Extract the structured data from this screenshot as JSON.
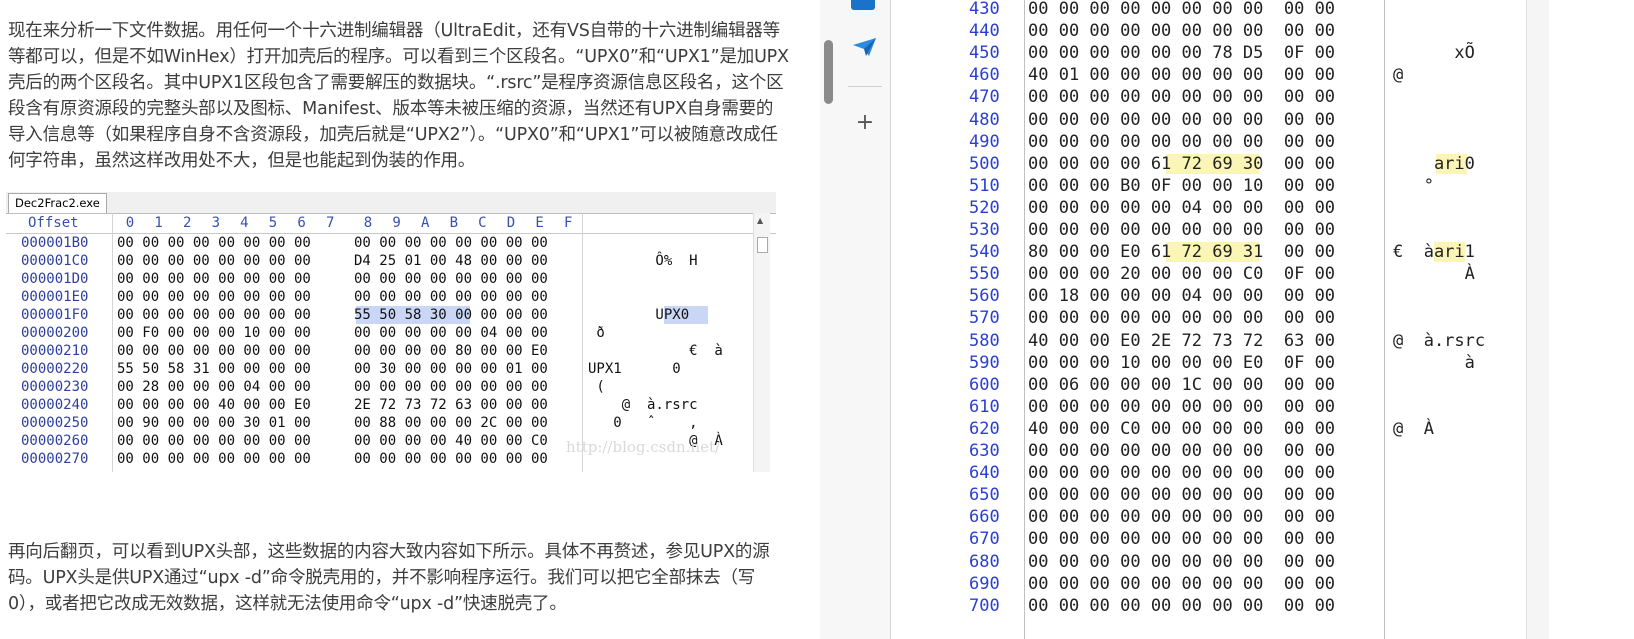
{
  "article": {
    "para1": [
      "现在来分析一下文件数据。用任何一个十六进制编辑器（UltraEdit，还有VS自带的十六进制编辑器等",
      "等都可以，但是不如WinHex）打开加壳后的程序。可以看到三个区段名。“UPX0”和“UPX1”是加UPX",
      "壳后的两个区段名。其中UPX1区段包含了需要解压的数据块。“.rsrc”是程序资源信息区段名，这个区",
      "段含有原资源段的完整头部以及图标、Manifest、版本等未被压缩的资源，当然还有UPX自身需要的",
      "导入信息等（如果程序自身不含资源段，加壳后就是“UPX2”）。“UPX0”和“UPX1”可以被随意改成任",
      "何字符串，虽然这样改用处不大，但是也能起到伪装的作用。"
    ],
    "para2": [
      "再向后翻页，可以看到UPX头部，这些数据的内容大致内容如下所示。具体不再赘述，参见UPX的源",
      "码。UPX头是供UPX通过“upx -d”命令脱壳用的，并不影响程序运行。我们可以把它全部抹去（写",
      "0），或者把它改成无效数据，这样就无法使用命令“upx -d”快速脱壳了。"
    ]
  },
  "winhex": {
    "tab": "Dec2Frac2.exe",
    "offset_label": "Offset",
    "columns": [
      "0",
      "1",
      "2",
      "3",
      "4",
      "5",
      "6",
      "7",
      "8",
      "9",
      "A",
      "B",
      "C",
      "D",
      "E",
      "F"
    ],
    "watermark": "http://blog.csdn.net/",
    "rows": [
      {
        "off": "000001B0",
        "h1": "00 00 00 00 00 00 00 00",
        "h2": "00 00 00 00 00 00 00 00",
        "asc": ""
      },
      {
        "off": "000001C0",
        "h1": "00 00 00 00 00 00 00 00",
        "h2": "D4 25 01 00 48 00 00 00",
        "asc": "        Ô%  H"
      },
      {
        "off": "000001D0",
        "h1": "00 00 00 00 00 00 00 00",
        "h2": "00 00 00 00 00 00 00 00",
        "asc": ""
      },
      {
        "off": "000001E0",
        "h1": "00 00 00 00 00 00 00 00",
        "h2": "00 00 00 00 00 00 00 00",
        "asc": ""
      },
      {
        "off": "000001F0",
        "h1": "00 00 00 00 00 00 00 00",
        "h2": "55 50 58 30 00 00 00 00",
        "asc": "        UPX0"
      },
      {
        "off": "00000200",
        "h1": "00 F0 00 00 00 10 00 00",
        "h2": "00 00 00 00 00 04 00 00",
        "asc": " ð"
      },
      {
        "off": "00000210",
        "h1": "00 00 00 00 00 00 00 00",
        "h2": "00 00 00 00 80 00 00 E0",
        "asc": "            €  à"
      },
      {
        "off": "00000220",
        "h1": "55 50 58 31 00 00 00 00",
        "h2": "00 30 00 00 00 00 01 00",
        "asc": "UPX1      0"
      },
      {
        "off": "00000230",
        "h1": "00 28 00 00 00 04 00 00",
        "h2": "00 00 00 00 00 00 00 00",
        "asc": " ("
      },
      {
        "off": "00000240",
        "h1": "00 00 00 00 40 00 00 E0",
        "h2": "2E 72 73 72 63 00 00 00",
        "asc": "    @  à.rsrc"
      },
      {
        "off": "00000250",
        "h1": "00 90 00 00 00 30 01 00",
        "h2": "00 88 00 00 00 2C 00 00",
        "asc": "   0   ˆ    ,"
      },
      {
        "off": "00000260",
        "h1": "00 00 00 00 00 00 00 00",
        "h2": "00 00 00 00 40 00 00 C0",
        "asc": "            @  À"
      },
      {
        "off": "00000270",
        "h1": "00 00 00 00 00 00 00 00",
        "h2": "00 00 00 00 00 00 00 00",
        "asc": ""
      }
    ]
  },
  "hexview": {
    "rows": [
      {
        "a": "430",
        "b": "00 00 00 00 00 00 00 00  00 00",
        "c": ""
      },
      {
        "a": "440",
        "b": "00 00 00 00 00 00 00 00  00 00",
        "c": ""
      },
      {
        "a": "450",
        "b": "00 00 00 00 00 00 78 D5  0F 00",
        "c": "      xÕ"
      },
      {
        "a": "460",
        "b": "40 01 00 00 00 00 00 00  00 00",
        "c": "@"
      },
      {
        "a": "470",
        "b": "00 00 00 00 00 00 00 00  00 00",
        "c": ""
      },
      {
        "a": "480",
        "b": "00 00 00 00 00 00 00 00  00 00",
        "c": ""
      },
      {
        "a": "490",
        "b": "00 00 00 00 00 00 00 00  00 00",
        "c": ""
      },
      {
        "a": "500",
        "b": "00 00 00 00 61 72 69 30  00 00",
        "c": "    ari0"
      },
      {
        "a": "510",
        "b": "00 00 00 B0 0F 00 00 10  00 00",
        "c": "   °"
      },
      {
        "a": "520",
        "b": "00 00 00 00 00 04 00 00  00 00",
        "c": ""
      },
      {
        "a": "530",
        "b": "00 00 00 00 00 00 00 00  00 00",
        "c": ""
      },
      {
        "a": "540",
        "b": "80 00 00 E0 61 72 69 31  00 00",
        "c": "€  àari1"
      },
      {
        "a": "550",
        "b": "00 00 00 20 00 00 00 C0  0F 00",
        "c": "       À"
      },
      {
        "a": "560",
        "b": "00 18 00 00 00 04 00 00  00 00",
        "c": ""
      },
      {
        "a": "570",
        "b": "00 00 00 00 00 00 00 00  00 00",
        "c": ""
      },
      {
        "a": "580",
        "b": "40 00 00 E0 2E 72 73 72  63 00",
        "c": "@  à.rsrc"
      },
      {
        "a": "590",
        "b": "00 00 00 10 00 00 00 E0  0F 00",
        "c": "       à"
      },
      {
        "a": "600",
        "b": "00 06 00 00 00 1C 00 00  00 00",
        "c": ""
      },
      {
        "a": "610",
        "b": "00 00 00 00 00 00 00 00  00 00",
        "c": ""
      },
      {
        "a": "620",
        "b": "40 00 00 C0 00 00 00 00  00 00",
        "c": "@  À"
      },
      {
        "a": "630",
        "b": "00 00 00 00 00 00 00 00  00 00",
        "c": ""
      },
      {
        "a": "640",
        "b": "00 00 00 00 00 00 00 00  00 00",
        "c": ""
      },
      {
        "a": "650",
        "b": "00 00 00 00 00 00 00 00  00 00",
        "c": ""
      },
      {
        "a": "660",
        "b": "00 00 00 00 00 00 00 00  00 00",
        "c": ""
      },
      {
        "a": "670",
        "b": "00 00 00 00 00 00 00 00  00 00",
        "c": ""
      },
      {
        "a": "680",
        "b": "00 00 00 00 00 00 00 00  00 00",
        "c": ""
      },
      {
        "a": "690",
        "b": "00 00 00 00 00 00 00 00  00 00",
        "c": ""
      },
      {
        "a": "700",
        "b": "00 00 00 00 00 00 00 00  00 00",
        "c": ""
      }
    ]
  },
  "sidebar": {
    "icons": [
      "app-icon",
      "send-icon",
      "add-icon"
    ],
    "plus_glyph": "+"
  },
  "colors": {
    "offset_blue": "#2a3fd1",
    "highlight": "#fbf6b5",
    "selection": "#c9d6f5"
  }
}
